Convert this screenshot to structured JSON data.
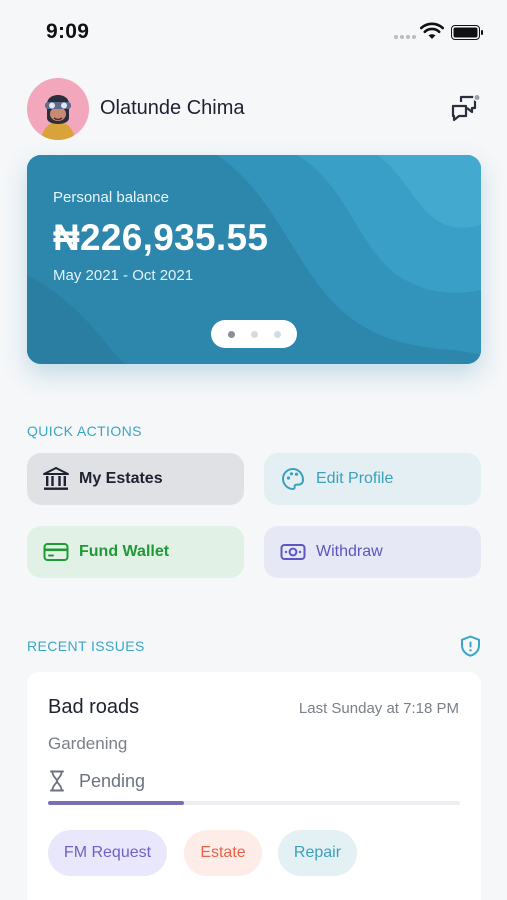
{
  "status_bar": {
    "time": "9:09"
  },
  "header": {
    "user_name": "Olatunde Chima"
  },
  "balance_card": {
    "label": "Personal balance",
    "amount": "₦226,935.55",
    "period": "May 2021 - Oct 2021",
    "active_page": 1,
    "page_count": 3
  },
  "quick_actions": {
    "title": "QUICK ACTIONS",
    "items": [
      {
        "label": "My Estates",
        "icon": "bank-icon"
      },
      {
        "label": "Edit Profile",
        "icon": "palette-icon"
      },
      {
        "label": "Fund Wallet",
        "icon": "card-icon"
      },
      {
        "label": "Withdraw",
        "icon": "cash-icon"
      }
    ]
  },
  "recent_issues": {
    "title": "RECENT ISSUES",
    "icon": "shield-icon",
    "issue": {
      "title": "Bad roads",
      "time": "Last Sunday at 7:18 PM",
      "category": "Gardening",
      "status": "Pending",
      "progress": 0.33,
      "tags": [
        "FM Request",
        "Estate",
        "Repair"
      ]
    }
  },
  "colors": {
    "accent": "#3aa6c6",
    "card": "#2f88ad",
    "fund": "#1f9a36",
    "withdraw": "#5d55c2",
    "estate_tag": "#e9624a"
  }
}
